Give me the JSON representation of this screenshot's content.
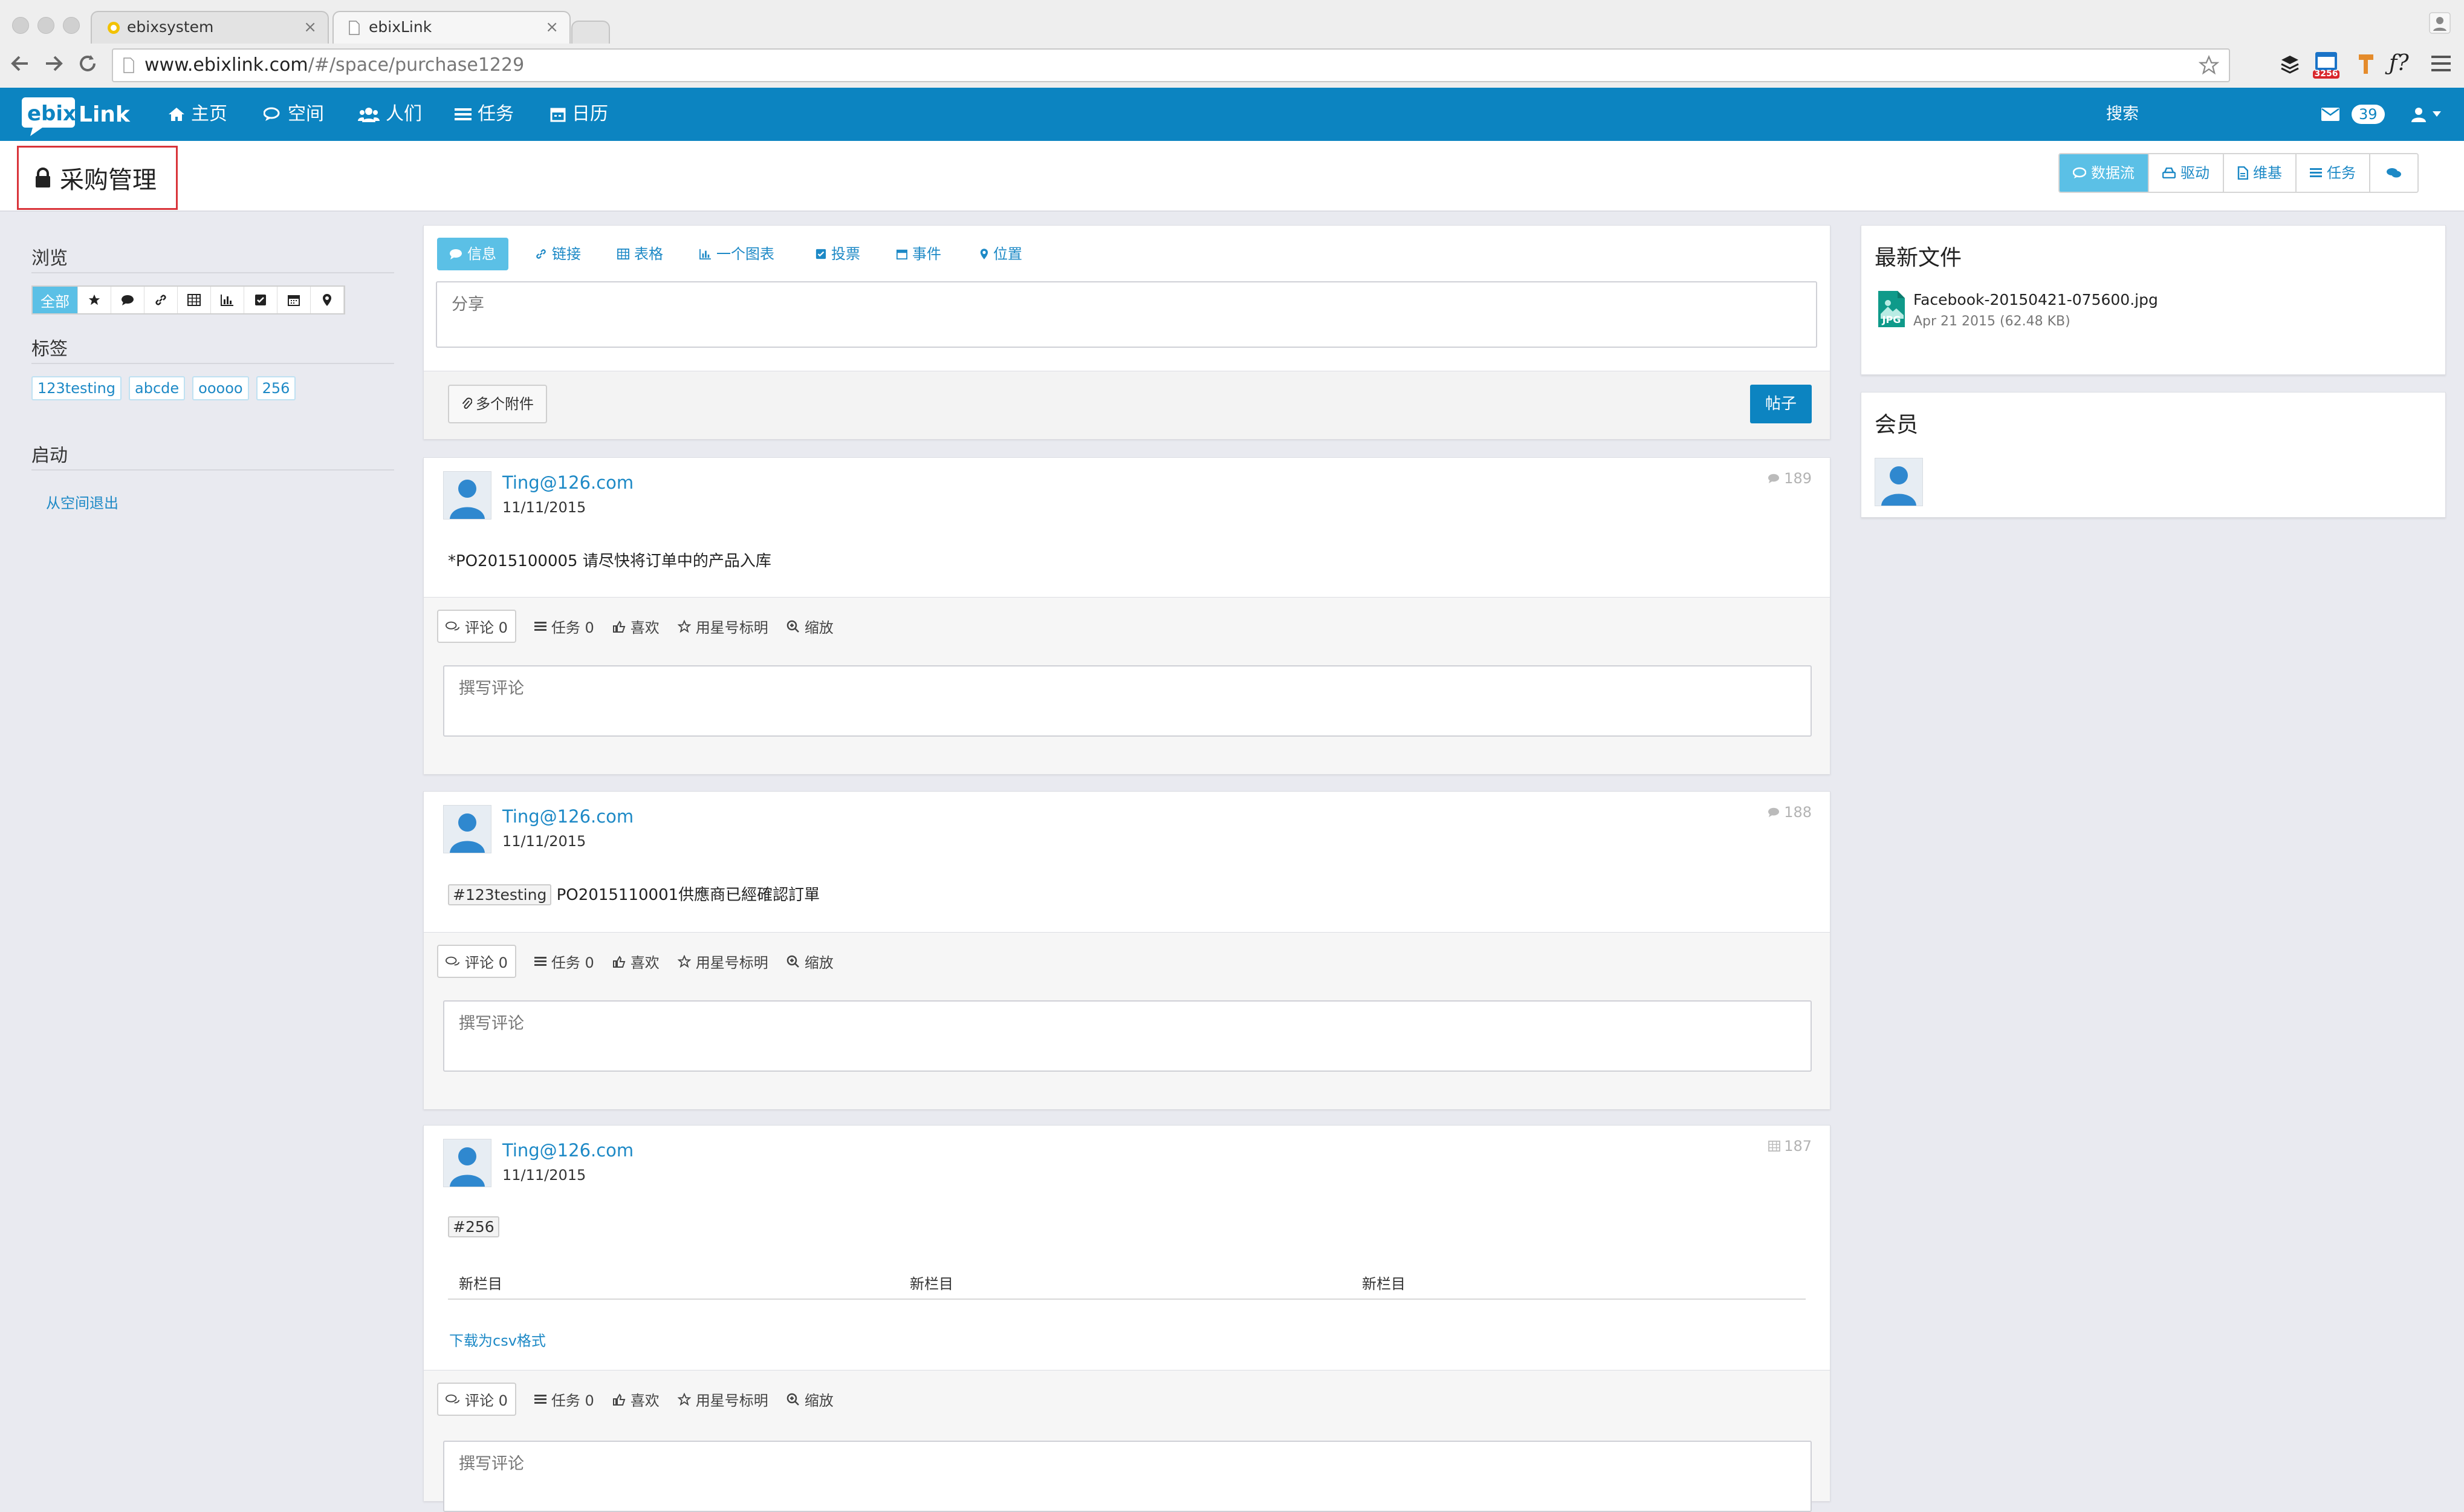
{
  "browser": {
    "tabs": [
      {
        "label": "ebixsystem",
        "active": false
      },
      {
        "label": "ebixLink",
        "active": true
      }
    ],
    "url_host": "www.ebixlink.com",
    "url_path": "/#/space/purchase1229",
    "ext_badge": "3256"
  },
  "navbar": {
    "items": [
      {
        "label": "主页",
        "icon": "home-icon"
      },
      {
        "label": "空间",
        "icon": "comments-icon"
      },
      {
        "label": "人们",
        "icon": "users-icon"
      },
      {
        "label": "任务",
        "icon": "list-icon"
      },
      {
        "label": "日历",
        "icon": "calendar-icon"
      }
    ],
    "search_label": "搜索",
    "mail_count": "39",
    "brand_color": "#0c84c1"
  },
  "space": {
    "title": "采购管理",
    "view_buttons": [
      {
        "label": "数据流",
        "active": true
      },
      {
        "label": "驱动",
        "active": false
      },
      {
        "label": "维基",
        "active": false
      },
      {
        "label": "任务",
        "active": false
      },
      {
        "label": "",
        "active": false
      }
    ]
  },
  "sidebar": {
    "browse_heading": "浏览",
    "filter_all": "全部",
    "tags_heading": "标签",
    "tags": [
      "123testing",
      "abcde",
      "ooooo",
      "256"
    ],
    "actions_heading": "启动",
    "leave_link": "从空间退出"
  },
  "publisher": {
    "tabs": [
      "信息",
      "链接",
      "表格",
      "一个图表",
      "投票",
      "事件",
      "位置"
    ],
    "share_placeholder": "分享",
    "attach_label": "多个附件",
    "post_label": "帖子"
  },
  "actions_labels": {
    "comment": "评论 0",
    "task": "任务 0",
    "like": "喜欢",
    "star": "用星号标明",
    "zoom": "缩放",
    "comment_placeholder": "撰写评论"
  },
  "posts": [
    {
      "author": "Ting@126.com",
      "date": "11/11/2015",
      "count": "189",
      "body": "*PO2015100005 请尽快将订单中的产品入库"
    },
    {
      "author": "Ting@126.com",
      "date": "11/11/2015",
      "count": "188",
      "hashtag": "#123testing",
      "body": "PO2015110001供應商已經確認訂單"
    },
    {
      "author": "Ting@126.com",
      "date": "11/11/2015",
      "count": "187",
      "hashtag": "#256",
      "table_headers": [
        "新栏目",
        "新栏目",
        "新栏目"
      ],
      "csv_link": "下载为csv格式"
    }
  ],
  "right": {
    "files_title": "最新文件",
    "file_name": "Facebook-20150421-075600.jpg",
    "file_meta": "Apr 21 2015 (62.48 KB)",
    "file_type": "JPG",
    "members_title": "会员"
  }
}
